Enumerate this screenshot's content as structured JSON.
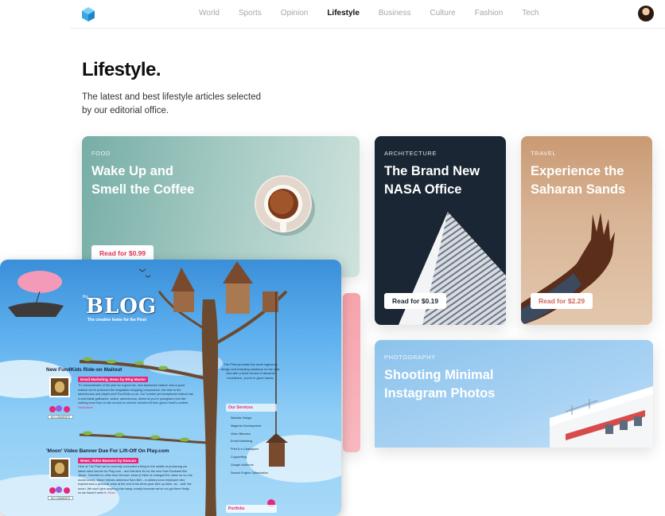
{
  "nav": {
    "items": [
      "World",
      "Sports",
      "Opinion",
      "Lifestyle",
      "Business",
      "Culture",
      "Fashion",
      "Tech"
    ],
    "active": "Lifestyle"
  },
  "hero": {
    "title": "Lifestyle.",
    "subtitle_line1": "The latest and best lifestyle articles selected",
    "subtitle_line2": "by our editorial office."
  },
  "cards": {
    "food": {
      "category": "FOOD",
      "title_line1": "Wake Up and",
      "title_line2": "Smell the Coffee",
      "button": "Read for $0.99"
    },
    "architecture": {
      "category": "ARCHITECTURE",
      "title_line1": "The Brand New",
      "title_line2": "NASA Office",
      "button": "Read for $0.19"
    },
    "travel": {
      "category": "TRAVEL",
      "title_line1": "Experience the",
      "title_line2": "Saharan Sands",
      "button": "Read for $2.29"
    },
    "photography": {
      "category": "PHOTOGRAPHY",
      "title_line1": "Shooting Minimal",
      "title_line2": "Instagram Photos"
    }
  },
  "blog": {
    "logo": "BLOG",
    "logo_pre": "the",
    "tagline": "The creative home for the Pixel",
    "intro": "The Pixel provides the most ingenious design and branding solutions on the web. And with a track record of absolute excellence, you're in good hands.",
    "posts": [
      {
        "title": "New Fun4Kids Ride-on Mailout",
        "meta": "Email Marketing, News by Blog Master",
        "body": "Th' extraordinaire of the year for a good ole, new fashioned mailout. And a good mailout we've produced the megaslide-shopping companions, this time to the adventurous and playful sort! Fun4Kids.co.uk. Our humble yet exceptional mailout has a somewhat gallivanter, action, adventurous, aimed at you're youngsters that like nothing more than to ride around on electric vehicles till their gizmo heart's content.",
        "more": "Read More",
        "comments": "NO COMMENTS"
      },
      {
        "title": "'Moon' Video Banner Due For Lift-Off On Play.com",
        "meta": "News, Video Banners by Duncan",
        "body": "Here at The Pixel we've currently concocted a thing in the middle of producing our latest video banner for Play.com – and this time it's for the new Sam Rockwell film 'Moon'. Directed no other than Duncan Jones (I think he changed the name so no one would know), 'Moon' follows astronaut Sam Bell – a solitary lunar employee who experiences a personal crisis at the end of his three-year stint up there, as... well, the moon. We won't give anything else away, mostly because we've not got there firstly, so we haven't seen it.",
        "more": "Read",
        "comments": "NO COMMENTS"
      }
    ],
    "services_title": "Our Services",
    "services": [
      "Website Design",
      "Magento Development",
      "Video Banners",
      "Email Marketing",
      "Print & e-Catalogues",
      "Copywriting",
      "Google AdWords",
      "Search Engine Optimisation"
    ],
    "portfolio_title": "Portfolio"
  },
  "colors": {
    "accent_pink": "#e0335a",
    "blog_pink": "#e6287c",
    "logo_cube": "#3aa8e6"
  }
}
